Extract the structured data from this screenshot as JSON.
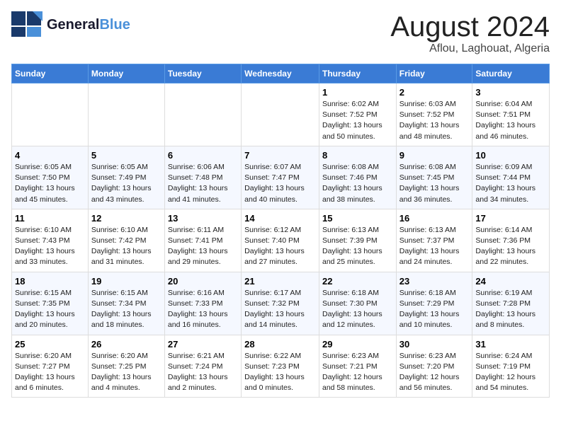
{
  "logo": {
    "line1": "General",
    "line2": "Blue",
    "tagline": ""
  },
  "title": "August 2024",
  "subtitle": "Aflou, Laghouat, Algeria",
  "days_of_week": [
    "Sunday",
    "Monday",
    "Tuesday",
    "Wednesday",
    "Thursday",
    "Friday",
    "Saturday"
  ],
  "weeks": [
    [
      {
        "day": "",
        "info": ""
      },
      {
        "day": "",
        "info": ""
      },
      {
        "day": "",
        "info": ""
      },
      {
        "day": "",
        "info": ""
      },
      {
        "day": "1",
        "info": "Sunrise: 6:02 AM\nSunset: 7:52 PM\nDaylight: 13 hours\nand 50 minutes."
      },
      {
        "day": "2",
        "info": "Sunrise: 6:03 AM\nSunset: 7:52 PM\nDaylight: 13 hours\nand 48 minutes."
      },
      {
        "day": "3",
        "info": "Sunrise: 6:04 AM\nSunset: 7:51 PM\nDaylight: 13 hours\nand 46 minutes."
      }
    ],
    [
      {
        "day": "4",
        "info": "Sunrise: 6:05 AM\nSunset: 7:50 PM\nDaylight: 13 hours\nand 45 minutes."
      },
      {
        "day": "5",
        "info": "Sunrise: 6:05 AM\nSunset: 7:49 PM\nDaylight: 13 hours\nand 43 minutes."
      },
      {
        "day": "6",
        "info": "Sunrise: 6:06 AM\nSunset: 7:48 PM\nDaylight: 13 hours\nand 41 minutes."
      },
      {
        "day": "7",
        "info": "Sunrise: 6:07 AM\nSunset: 7:47 PM\nDaylight: 13 hours\nand 40 minutes."
      },
      {
        "day": "8",
        "info": "Sunrise: 6:08 AM\nSunset: 7:46 PM\nDaylight: 13 hours\nand 38 minutes."
      },
      {
        "day": "9",
        "info": "Sunrise: 6:08 AM\nSunset: 7:45 PM\nDaylight: 13 hours\nand 36 minutes."
      },
      {
        "day": "10",
        "info": "Sunrise: 6:09 AM\nSunset: 7:44 PM\nDaylight: 13 hours\nand 34 minutes."
      }
    ],
    [
      {
        "day": "11",
        "info": "Sunrise: 6:10 AM\nSunset: 7:43 PM\nDaylight: 13 hours\nand 33 minutes."
      },
      {
        "day": "12",
        "info": "Sunrise: 6:10 AM\nSunset: 7:42 PM\nDaylight: 13 hours\nand 31 minutes."
      },
      {
        "day": "13",
        "info": "Sunrise: 6:11 AM\nSunset: 7:41 PM\nDaylight: 13 hours\nand 29 minutes."
      },
      {
        "day": "14",
        "info": "Sunrise: 6:12 AM\nSunset: 7:40 PM\nDaylight: 13 hours\nand 27 minutes."
      },
      {
        "day": "15",
        "info": "Sunrise: 6:13 AM\nSunset: 7:39 PM\nDaylight: 13 hours\nand 25 minutes."
      },
      {
        "day": "16",
        "info": "Sunrise: 6:13 AM\nSunset: 7:37 PM\nDaylight: 13 hours\nand 24 minutes."
      },
      {
        "day": "17",
        "info": "Sunrise: 6:14 AM\nSunset: 7:36 PM\nDaylight: 13 hours\nand 22 minutes."
      }
    ],
    [
      {
        "day": "18",
        "info": "Sunrise: 6:15 AM\nSunset: 7:35 PM\nDaylight: 13 hours\nand 20 minutes."
      },
      {
        "day": "19",
        "info": "Sunrise: 6:15 AM\nSunset: 7:34 PM\nDaylight: 13 hours\nand 18 minutes."
      },
      {
        "day": "20",
        "info": "Sunrise: 6:16 AM\nSunset: 7:33 PM\nDaylight: 13 hours\nand 16 minutes."
      },
      {
        "day": "21",
        "info": "Sunrise: 6:17 AM\nSunset: 7:32 PM\nDaylight: 13 hours\nand 14 minutes."
      },
      {
        "day": "22",
        "info": "Sunrise: 6:18 AM\nSunset: 7:30 PM\nDaylight: 13 hours\nand 12 minutes."
      },
      {
        "day": "23",
        "info": "Sunrise: 6:18 AM\nSunset: 7:29 PM\nDaylight: 13 hours\nand 10 minutes."
      },
      {
        "day": "24",
        "info": "Sunrise: 6:19 AM\nSunset: 7:28 PM\nDaylight: 13 hours\nand 8 minutes."
      }
    ],
    [
      {
        "day": "25",
        "info": "Sunrise: 6:20 AM\nSunset: 7:27 PM\nDaylight: 13 hours\nand 6 minutes."
      },
      {
        "day": "26",
        "info": "Sunrise: 6:20 AM\nSunset: 7:25 PM\nDaylight: 13 hours\nand 4 minutes."
      },
      {
        "day": "27",
        "info": "Sunrise: 6:21 AM\nSunset: 7:24 PM\nDaylight: 13 hours\nand 2 minutes."
      },
      {
        "day": "28",
        "info": "Sunrise: 6:22 AM\nSunset: 7:23 PM\nDaylight: 13 hours\nand 0 minutes."
      },
      {
        "day": "29",
        "info": "Sunrise: 6:23 AM\nSunset: 7:21 PM\nDaylight: 12 hours\nand 58 minutes."
      },
      {
        "day": "30",
        "info": "Sunrise: 6:23 AM\nSunset: 7:20 PM\nDaylight: 12 hours\nand 56 minutes."
      },
      {
        "day": "31",
        "info": "Sunrise: 6:24 AM\nSunset: 7:19 PM\nDaylight: 12 hours\nand 54 minutes."
      }
    ]
  ]
}
